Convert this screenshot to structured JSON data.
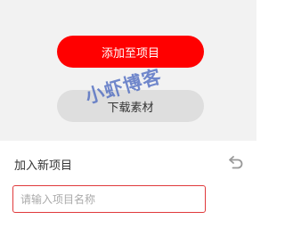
{
  "actions": {
    "add_to_project_label": "添加至项目",
    "download_material_label": "下载素材"
  },
  "watermark": {
    "text": "小虾博客"
  },
  "new_project": {
    "title": "加入新项目",
    "undo_icon": "undo-icon",
    "name_input_value": "",
    "name_input_placeholder": "请输入项目名称"
  },
  "colors": {
    "primary_red": "#ff0000",
    "secondary_gray": "#dedede",
    "input_border": "#e0393b",
    "watermark_blue": "#3f5fbd"
  }
}
